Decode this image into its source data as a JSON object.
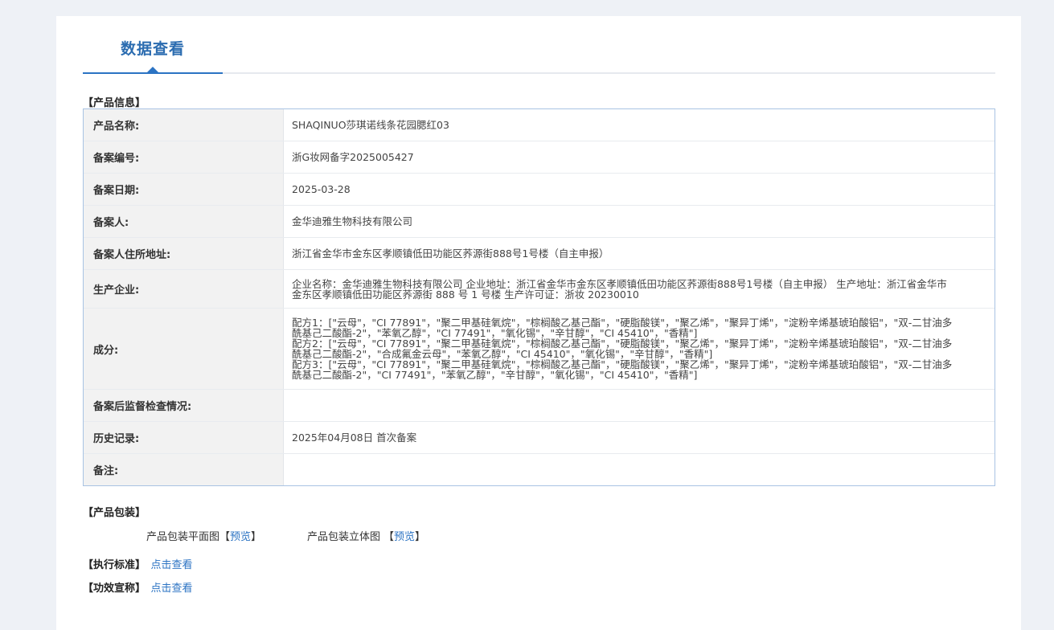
{
  "tab": {
    "title": "数据查看"
  },
  "product_info": {
    "section_title": "【产品信息】",
    "rows": [
      {
        "label": "产品名称:",
        "value": "SHAQINUO莎琪诺线条花园腮红03"
      },
      {
        "label": "备案编号:",
        "value": "浙G妆网备字2025005427"
      },
      {
        "label": "备案日期:",
        "value": "2025-03-28"
      },
      {
        "label": "备案人:",
        "value": "金华迪雅生物科技有限公司"
      },
      {
        "label": "备案人住所地址:",
        "value": "浙江省金华市金东区孝顺镇低田功能区荞源街888号1号楼（自主申报）"
      },
      {
        "label": "生产企业:",
        "value": "企业名称：金华迪雅生物科技有限公司 企业地址：浙江省金华市金东区孝顺镇低田功能区荞源街888号1号楼（自主申报） 生产地址：浙江省金华市金东区孝顺镇低田功能区荞源街 888 号 1 号楼 生产许可证：浙妆 20230010"
      },
      {
        "label": "成分:",
        "lines": [
          "配方1：[\"云母\"，\"CI 77891\"，\"聚二甲基硅氧烷\"，\"棕榈酸乙基己酯\"，\"硬脂酸镁\"，\"聚乙烯\"，\"聚异丁烯\"，\"淀粉辛烯基琥珀酸铝\"，\"双-二甘油多酰基己二酸酯-2\"，\"苯氧乙醇\"，\"CI 77491\"，\"氧化锡\"，\"辛甘醇\"，\"CI 45410\"，\"香精\"]",
          "配方2：[\"云母\"，\"CI 77891\"，\"聚二甲基硅氧烷\"，\"棕榈酸乙基己酯\"，\"硬脂酸镁\"，\"聚乙烯\"，\"聚异丁烯\"，\"淀粉辛烯基琥珀酸铝\"，\"双-二甘油多酰基己二酸酯-2\"，\"合成氟金云母\"，\"苯氧乙醇\"，\"CI 45410\"，\"氧化锡\"，\"辛甘醇\"，\"香精\"]",
          "配方3：[\"云母\"，\"CI 77891\"，\"聚二甲基硅氧烷\"，\"棕榈酸乙基己酯\"，\"硬脂酸镁\"，\"聚乙烯\"，\"聚异丁烯\"，\"淀粉辛烯基琥珀酸铝\"，\"双-二甘油多酰基己二酸酯-2\"，\"CI 77491\"，\"苯氧乙醇\"，\"辛甘醇\"，\"氧化锡\"，\"CI 45410\"，\"香精\"]"
        ]
      },
      {
        "label": "备案后监督检查情况:",
        "value": ""
      },
      {
        "label": "历史记录:",
        "value": "2025年04月08日 首次备案"
      },
      {
        "label": "备注:",
        "value": ""
      }
    ]
  },
  "packaging": {
    "section_title": "【产品包装】",
    "flat_label": "产品包装平面图",
    "flat_open": "【",
    "flat_link": "预览",
    "flat_close": "】",
    "three_d_label": "产品包装立体图",
    "three_d_open": "【",
    "three_d_link": "预览",
    "three_d_close": "】"
  },
  "standard": {
    "section_title": "【执行标准】",
    "link": "点击查看"
  },
  "efficacy": {
    "section_title": "【功效宣称】",
    "link": "点击查看"
  },
  "colors": {
    "accent": "#2b73c3",
    "label_bg": "#f2f2f2",
    "table_border": "#a9c3e3"
  }
}
